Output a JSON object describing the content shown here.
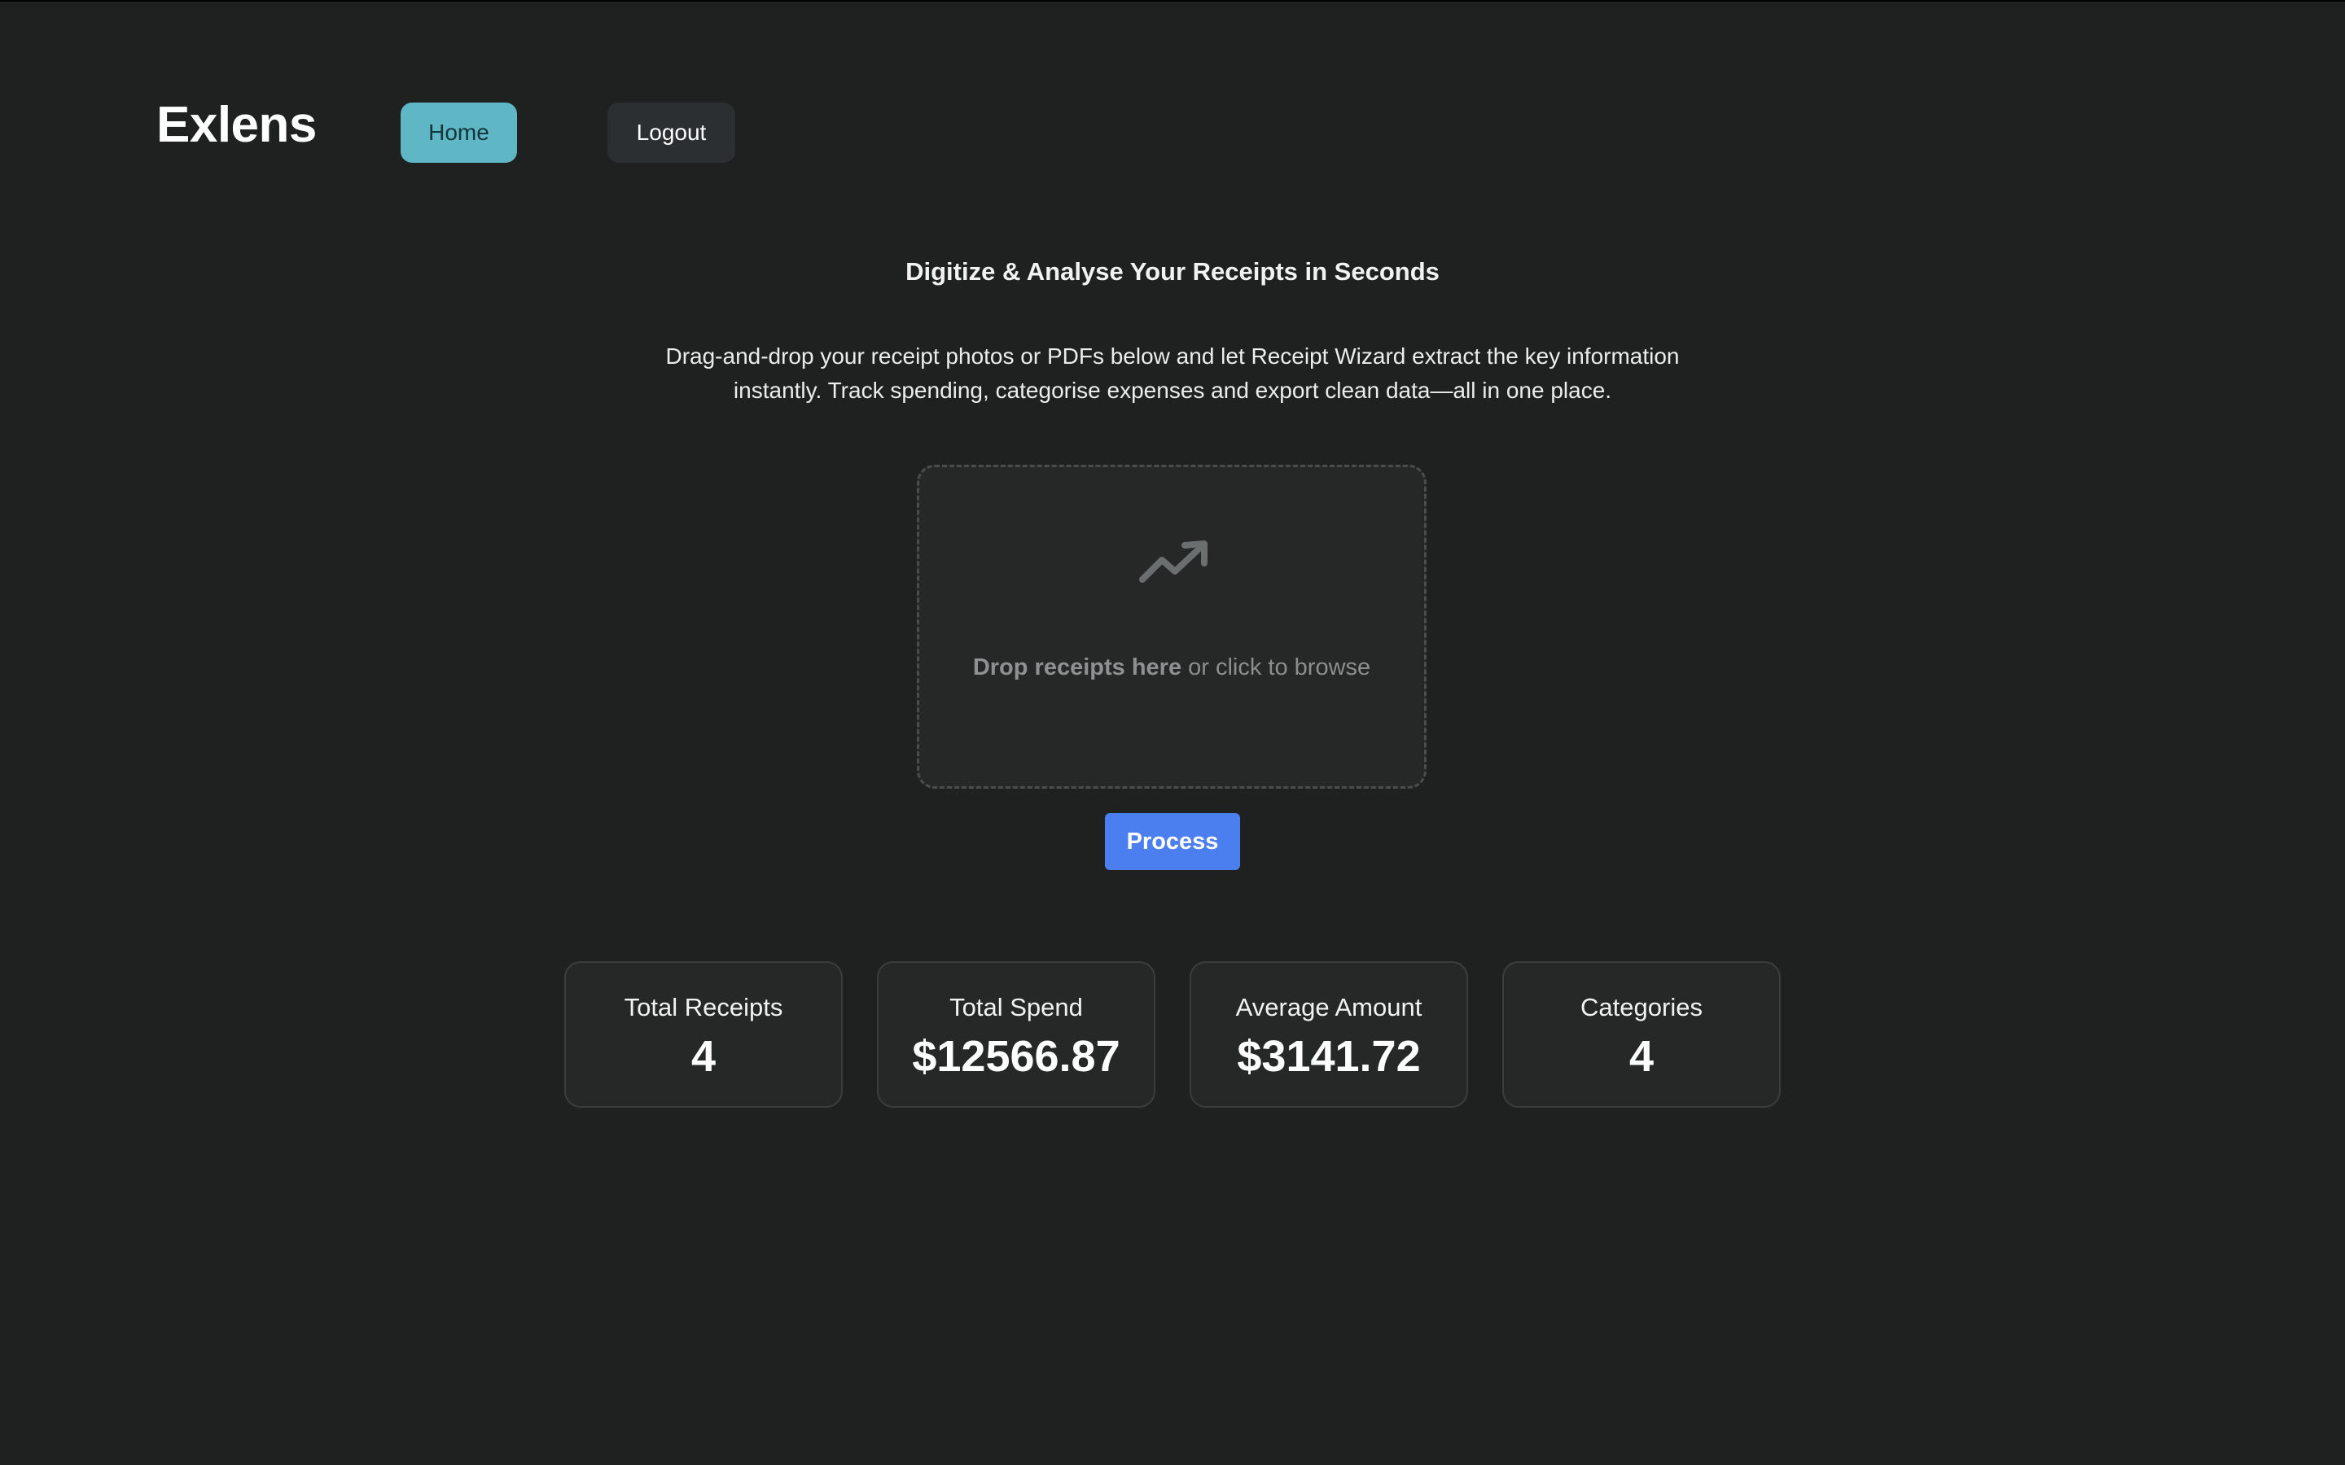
{
  "app": {
    "brand": "Exlens"
  },
  "nav": {
    "home_label": "Home",
    "logout_label": "Logout"
  },
  "hero": {
    "headline": "Digitize & Analyse Your Receipts in Seconds",
    "description": "Drag-and-drop your receipt photos or PDFs below and let Receipt Wizard extract the key information instantly. Track spending, categorise expenses and export clean data—all in one place."
  },
  "upload": {
    "icon": "trending-up-icon",
    "prompt_bold": "Drop receipts here",
    "prompt_rest": " or click to browse",
    "process_label": "Process"
  },
  "stats": [
    {
      "label": "Total Receipts",
      "value": "4"
    },
    {
      "label": "Total Spend",
      "value": "$12566.87"
    },
    {
      "label": "Average Amount",
      "value": "$3141.72"
    },
    {
      "label": "Categories",
      "value": "4"
    }
  ],
  "colors": {
    "background": "#1f2121",
    "accent_home": "#5fb6c4",
    "primary_button": "#4b7fef"
  }
}
